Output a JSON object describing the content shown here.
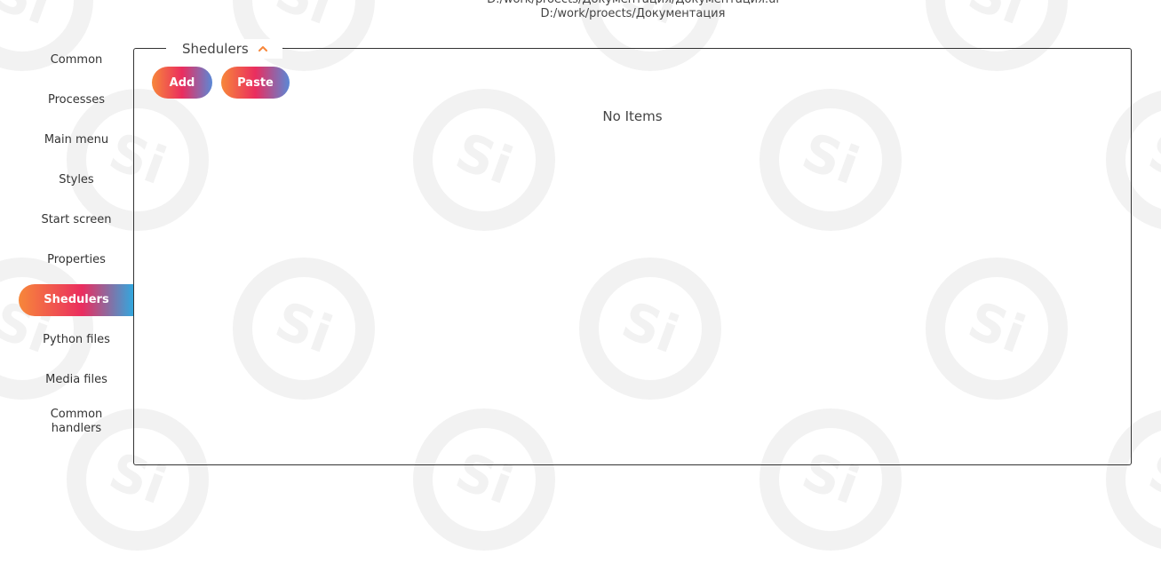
{
  "header": {
    "path_line_1": "D:/work/proects/Документация/Документация.ui",
    "path_line_2": "D:/work/proects/Документация"
  },
  "sidebar": {
    "items": [
      {
        "label": "Common"
      },
      {
        "label": "Processes"
      },
      {
        "label": "Main menu"
      },
      {
        "label": "Styles"
      },
      {
        "label": "Start screen"
      },
      {
        "label": "Properties"
      },
      {
        "label": "Shedulers",
        "active": true
      },
      {
        "label": "Python files"
      },
      {
        "label": "Media files"
      },
      {
        "label": "Common handlers"
      }
    ]
  },
  "panel": {
    "title": "Shedulers",
    "toggle_icon": "chevron-up-icon",
    "add_label": "Add",
    "paste_label": "Paste",
    "empty_text": "No Items"
  },
  "colors": {
    "accent_orange": "#f7873a",
    "accent_pink": "#ea2d5f",
    "accent_blue": "#2fa9e0"
  }
}
